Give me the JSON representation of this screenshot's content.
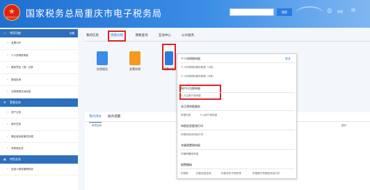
{
  "header": {
    "emblem_text": "国家税务总局",
    "title": "国家税务总局重庆市电子税务局",
    "search_button": "搜索",
    "welcome": "欢迎"
  },
  "sidebar": {
    "sections": [
      {
        "title": "常用功能",
        "settings": "设置",
        "items": [
          "发票代开",
          "个人所得税申报",
          "股收凭证（查）记录",
          "报送查询",
          "办税政策互动信息"
        ]
      },
      {
        "title": "套餐业务",
        "items": [
          "资产业务",
          "新开任务",
          "跨区域涉税事项办理",
          "车购税业务"
        ]
      },
      {
        "title": "特色业务",
        "items": [
          "自然人税收管理系统"
        ]
      }
    ]
  },
  "main": {
    "tabs": [
      "我的信息",
      "我要办税",
      "我要查询",
      "互动中心",
      "公众服务"
    ],
    "active_tab": 1,
    "icons": [
      {
        "label": "信息报告",
        "icon": "report-icon"
      },
      {
        "label": "发票办理",
        "icon": "invoice-icon"
      },
      {
        "label": "税费申报",
        "icon": "declare-icon"
      }
    ],
    "lower_tabs": [
      "我的待办",
      "服务提醒"
    ],
    "lower_header_name": "事项名称",
    "lower_header_op": "操作"
  },
  "dropdown": {
    "groups": [
      {
        "title": "个人所得税申报",
        "more": "更多",
        "items": [
          "个人所得税扣缴申报表（A表）",
          "个人所得税扣缴申报表（B表）"
        ]
      },
      {
        "title": "财产行为税申报",
        "items": [
          "个人住房产税申报"
        ]
      },
      {
        "title": "非正常申报服务",
        "items": [
          "申报失败",
          "个人房产税申报"
        ]
      },
      {
        "title": "申报信息更改打印",
        "items": [
          "申报信息查询及打印"
        ]
      },
      {
        "title": "车辆购置税申报",
        "items": [
          "车辆购置税申报"
        ]
      },
      {
        "title": "税费缴纳",
        "items": [
          "扣税款",
          "扣款信息查询",
          "扣款状态不明处理",
          "申报缴付凭据查询及打印"
        ]
      }
    ]
  }
}
